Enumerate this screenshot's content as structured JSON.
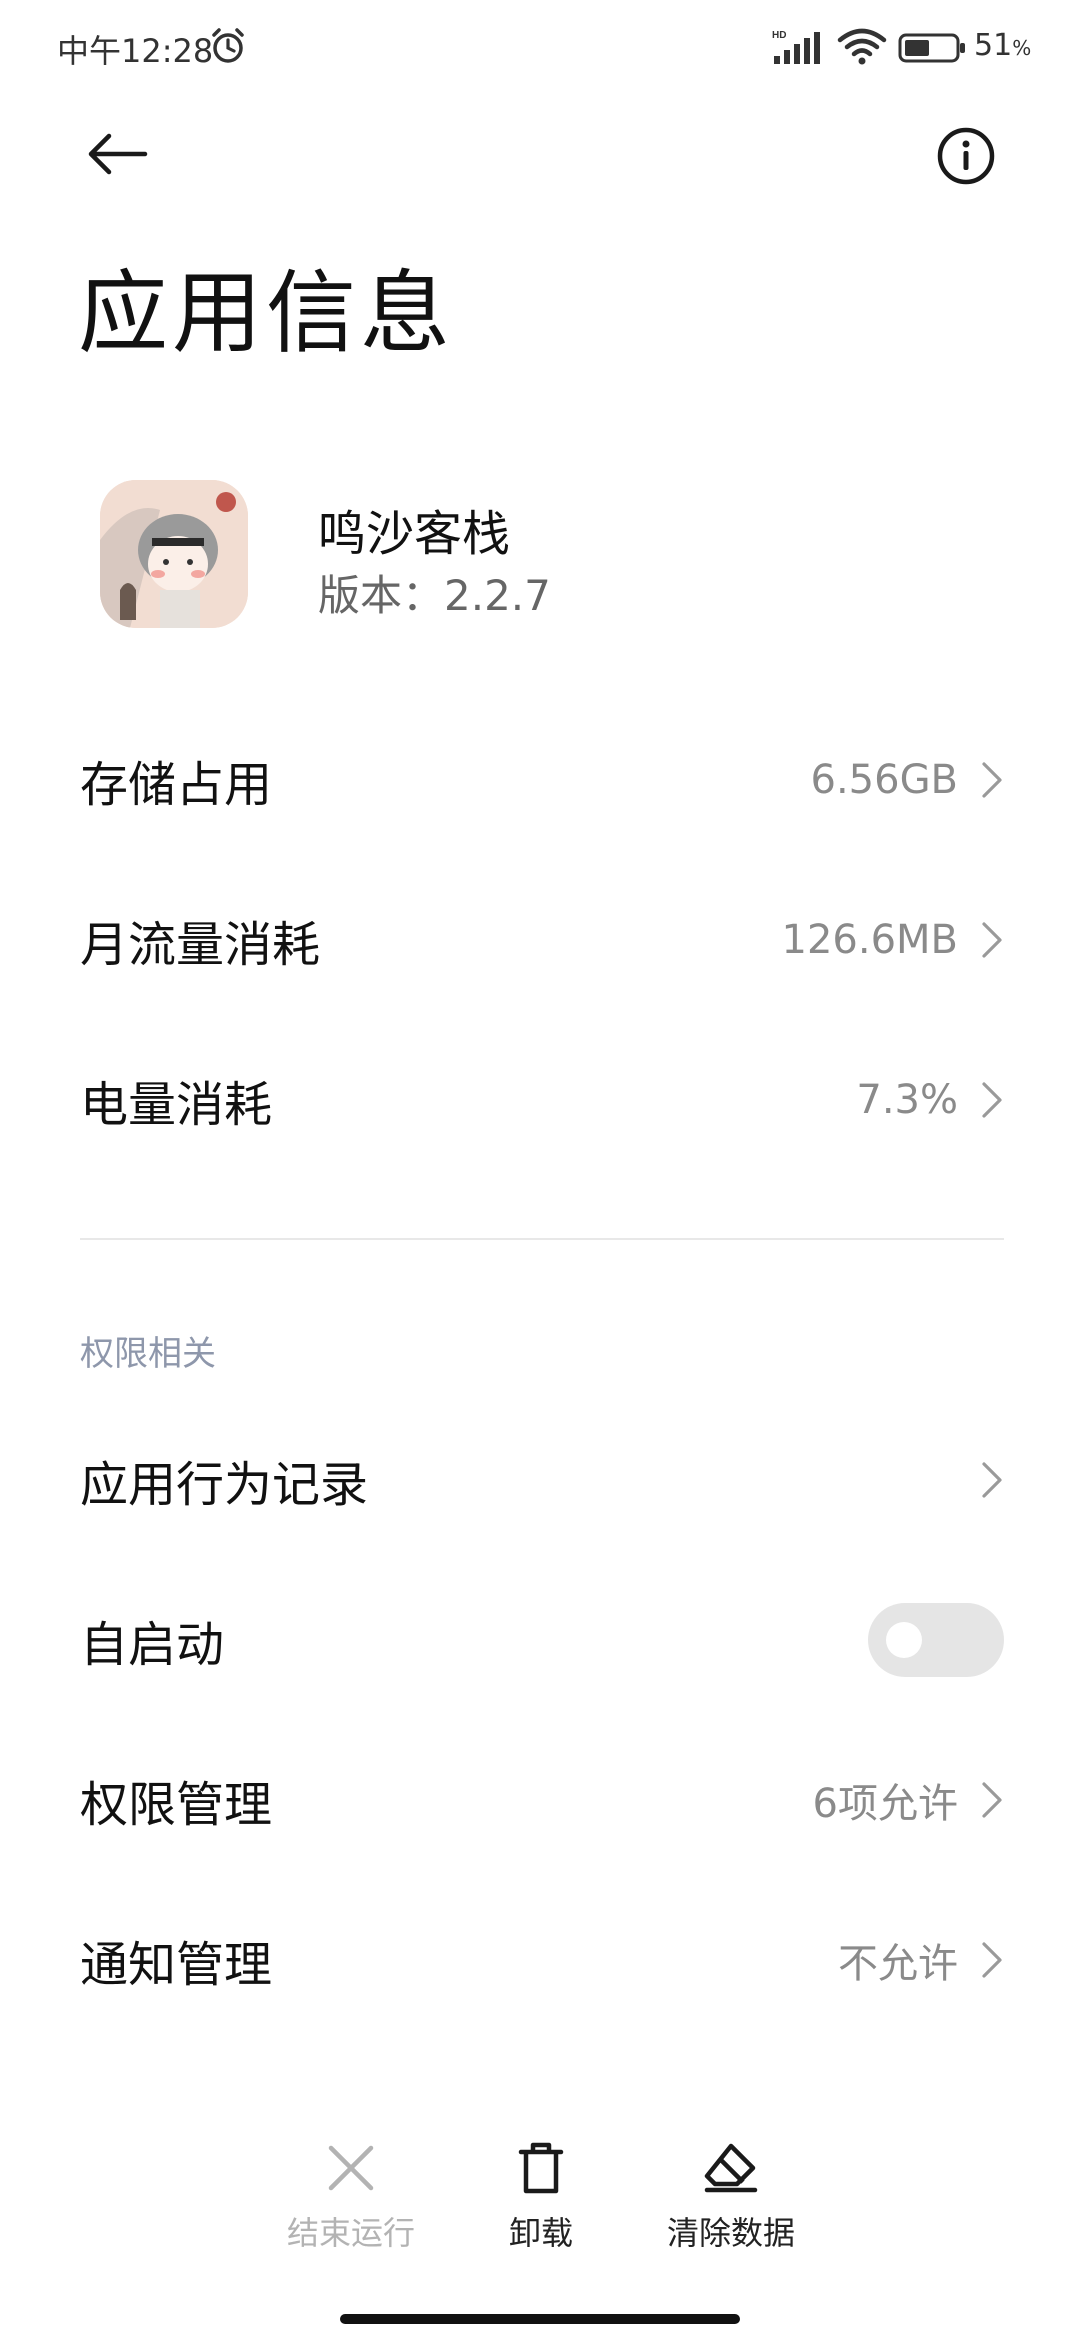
{
  "status_bar": {
    "time": "中午12:28",
    "battery_percent": "51",
    "battery_unit": "%",
    "battery_level": 0.51,
    "icons": [
      "alarm-icon",
      "signal-hd-icon",
      "wifi-icon",
      "battery-icon"
    ]
  },
  "header": {
    "back_icon": "arrow-left-icon",
    "info_icon": "info-circle-icon",
    "title": "应用信息"
  },
  "app": {
    "name": "鸣沙客栈",
    "version": "版本：2.2.7"
  },
  "usage_rows": [
    {
      "label": "存储占用",
      "value": "6.56GB"
    },
    {
      "label": "月流量消耗",
      "value": "126.6MB"
    },
    {
      "label": "电量消耗",
      "value": "7.3%"
    }
  ],
  "permissions_section": {
    "header": "权限相关",
    "behavior_record": {
      "label": "应用行为记录"
    },
    "autostart": {
      "label": "自启动",
      "enabled": false
    },
    "permission_manage": {
      "label": "权限管理",
      "value": "6项允许"
    },
    "notification_manage": {
      "label": "通知管理",
      "value": "不允许"
    }
  },
  "bottom_actions": [
    {
      "label": "结束运行",
      "icon": "close-x-icon",
      "enabled": false
    },
    {
      "label": "卸载",
      "icon": "trash-icon",
      "enabled": true
    },
    {
      "label": "清除数据",
      "icon": "eraser-icon",
      "enabled": true
    }
  ],
  "colors": {
    "section_header": "#8e97ab",
    "secondary_text": "#8a8a8a",
    "disabled_text": "#b3b3b3",
    "toggle_off": "#e5e5e5"
  }
}
